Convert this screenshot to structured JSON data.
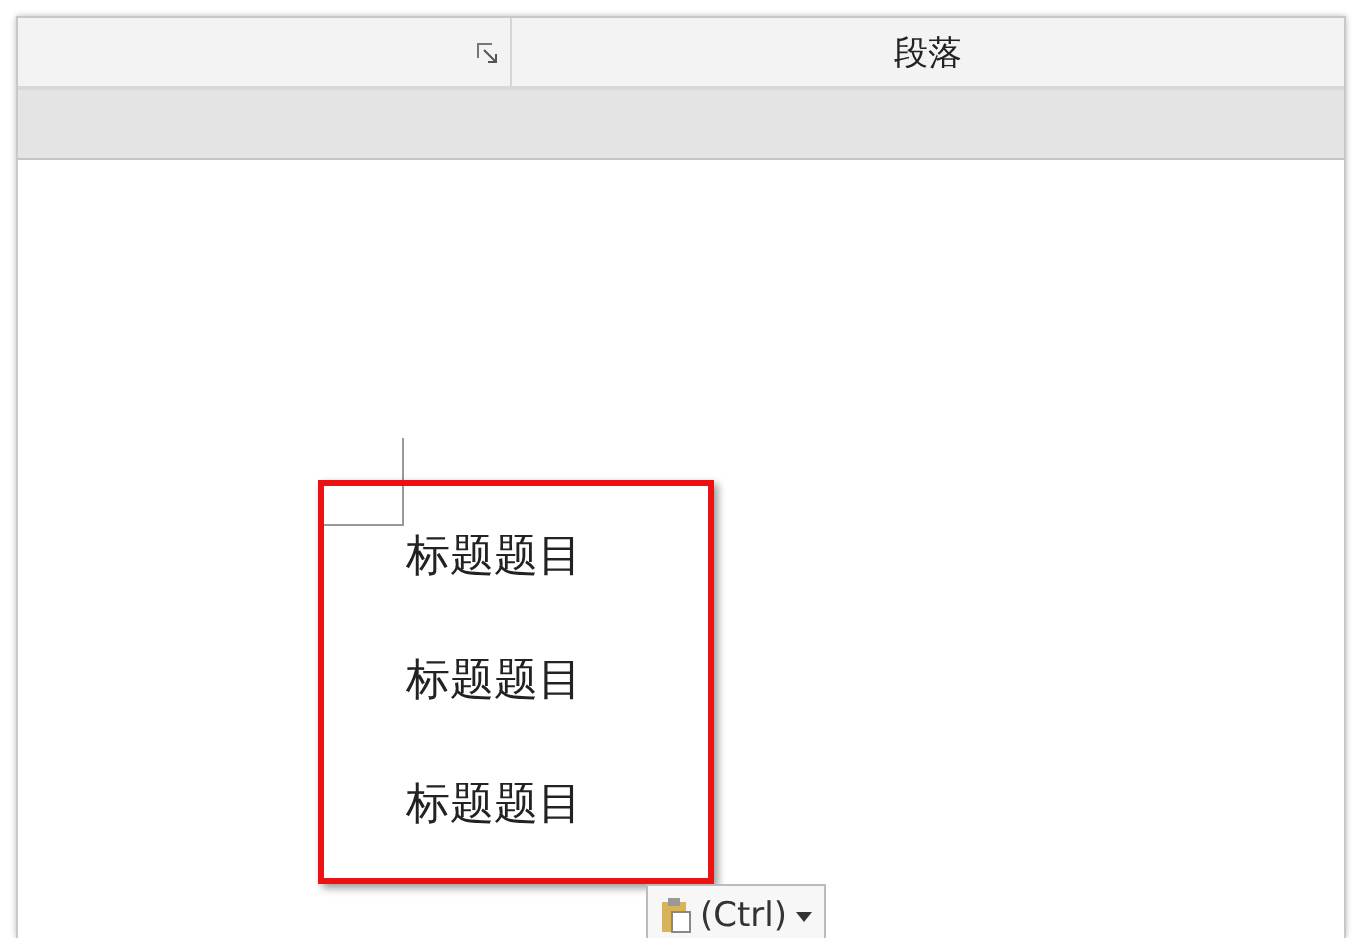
{
  "ribbon": {
    "groups": [
      {
        "has_launcher": true
      },
      {
        "label": "段落",
        "has_launcher": false
      }
    ]
  },
  "document": {
    "lines": [
      "标题题目",
      "标题题目",
      "标题题目"
    ],
    "highlighted": true
  },
  "paste_options": {
    "label": "(Ctrl)"
  }
}
